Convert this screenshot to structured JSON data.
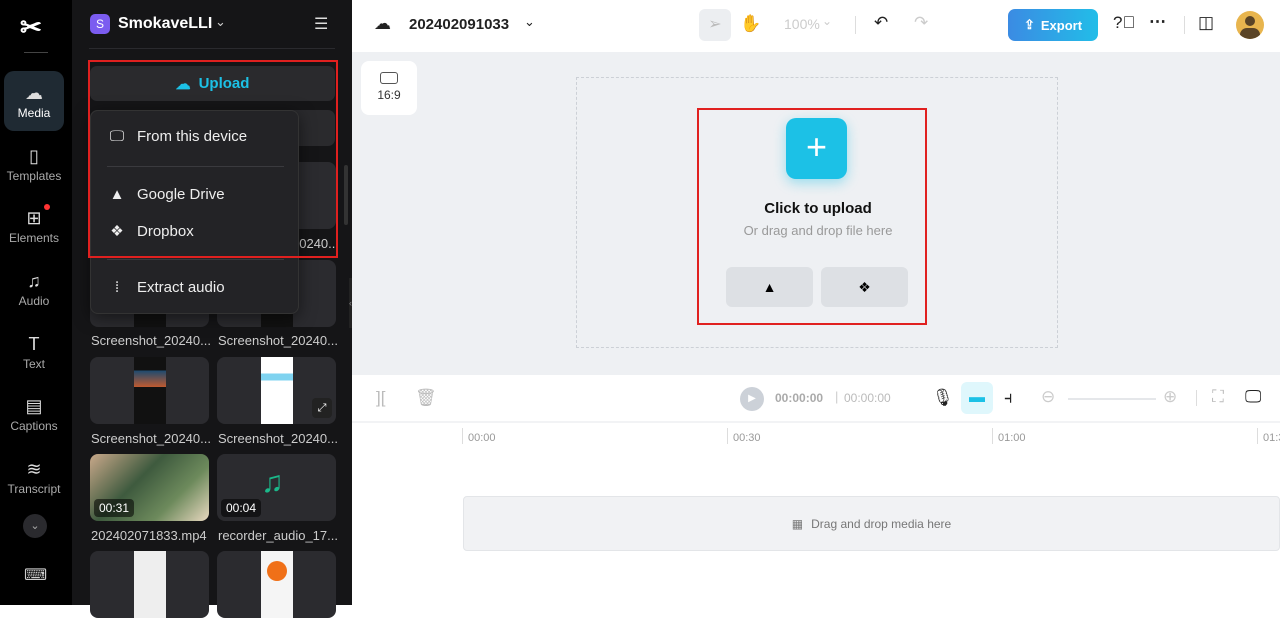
{
  "rail": {
    "items": [
      {
        "label": "Media",
        "icon": "cloud-upload-icon",
        "active": true
      },
      {
        "label": "Templates",
        "icon": "templates-icon"
      },
      {
        "label": "Elements",
        "icon": "elements-icon",
        "badge": true
      },
      {
        "label": "Audio",
        "icon": "music-note-icon"
      },
      {
        "label": "Text",
        "icon": "text-icon"
      },
      {
        "label": "Captions",
        "icon": "captions-icon"
      },
      {
        "label": "Transcript",
        "icon": "transcript-icon"
      }
    ]
  },
  "workspace": {
    "initial": "S",
    "name": "SmokaveLLI"
  },
  "panel": {
    "upload_label": "Upload",
    "menu": {
      "from_device": "From this device",
      "google_drive": "Google Drive",
      "dropbox": "Dropbox",
      "extract_audio": "Extract audio"
    },
    "media": [
      {
        "name": "Screenshot_20240..."
      },
      {
        "name": "Screenshot_20240..."
      },
      {
        "name": "Screenshot_20240..."
      },
      {
        "name": "Screenshot_20240..."
      },
      {
        "name": "Screenshot_20240..."
      },
      {
        "name": "Screenshot_20240..."
      },
      {
        "name": "202402071833.mp4",
        "duration": "00:31"
      },
      {
        "name": "recorder_audio_17...",
        "duration": "00:04"
      }
    ],
    "partial_label": "20240..."
  },
  "topbar": {
    "project": "202402091033",
    "zoom": "100%",
    "export": "Export"
  },
  "canvas": {
    "ratio": "16:9",
    "upload_title": "Click to upload",
    "upload_sub": "Or drag and drop file here"
  },
  "timeline": {
    "current": "00:00:00",
    "total": "00:00:00",
    "ticks": [
      "00:00",
      "00:30",
      "01:00",
      "01:3"
    ],
    "drop_hint": "Drag and drop media here"
  },
  "colors": {
    "accent": "#1cc1e6",
    "highlight": "#e0201f"
  }
}
